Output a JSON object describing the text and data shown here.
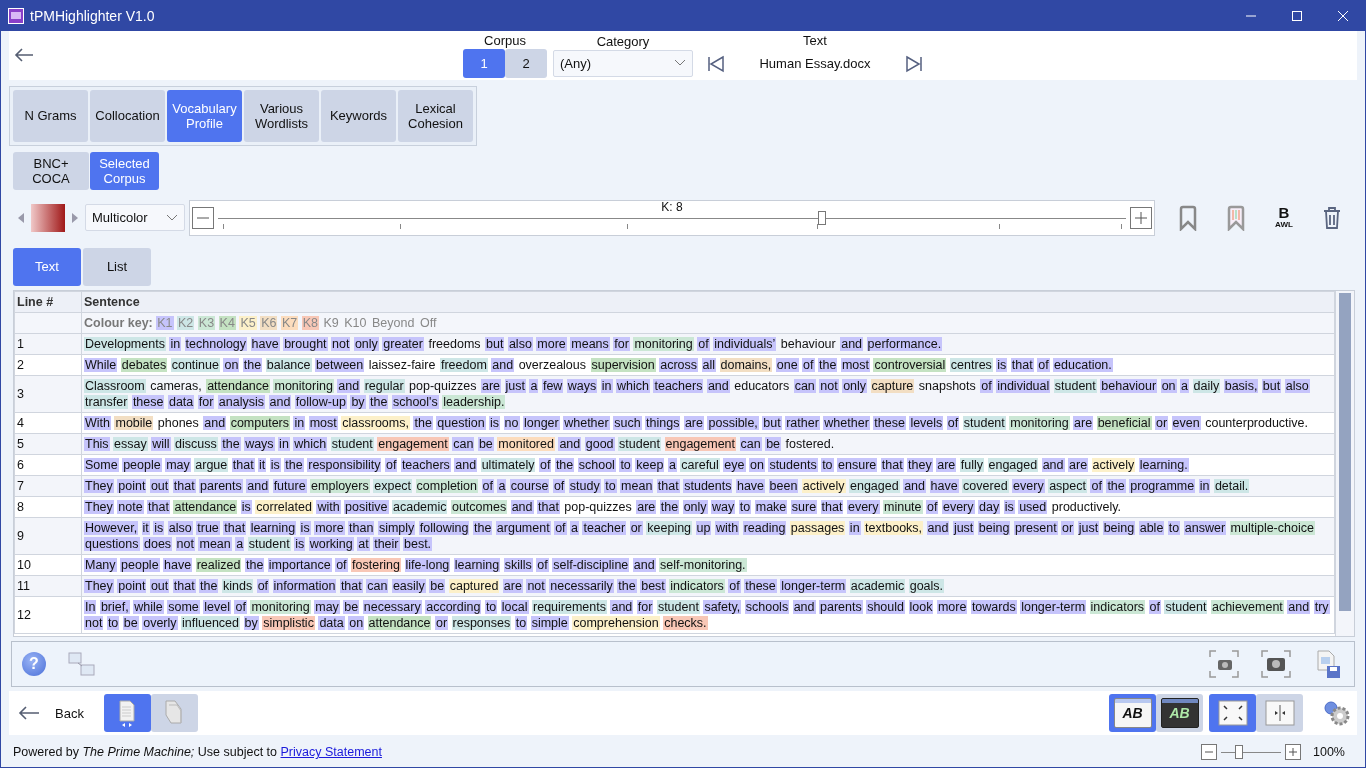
{
  "window": {
    "title": "tPMHighlighter V1.0"
  },
  "header": {
    "corpus": {
      "label": "Corpus",
      "options": [
        {
          "label": "1",
          "selected": true
        },
        {
          "label": "2",
          "selected": false
        }
      ]
    },
    "category": {
      "label": "Category",
      "value": "(Any)"
    },
    "text": {
      "label": "Text",
      "value": "Human Essay.docx"
    }
  },
  "tool_tabs": [
    {
      "label": "N Grams",
      "selected": false
    },
    {
      "label": "Collocation",
      "selected": false
    },
    {
      "label": "Vocabulary Profile",
      "selected": true
    },
    {
      "label": "Various Wordlists",
      "selected": false
    },
    {
      "label": "Keywords",
      "selected": false
    },
    {
      "label": "Lexical Cohesion",
      "selected": false
    }
  ],
  "reference_tabs": [
    {
      "label": "BNC+ COCA",
      "selected": false
    },
    {
      "label": "Selected Corpus",
      "selected": true
    }
  ],
  "palette": {
    "value": "Multicolor"
  },
  "k_slider": {
    "reading": "K: 8",
    "level": 0.665
  },
  "awl_button": {
    "letter": "B",
    "label": "AWL"
  },
  "view_tabs": [
    {
      "label": "Text",
      "selected": true
    },
    {
      "label": "List",
      "selected": false
    }
  ],
  "table": {
    "columns": [
      "Line #",
      "Sentence"
    ],
    "colour_key": {
      "label": "Colour key:",
      "items": [
        {
          "text": "K1",
          "color": "#c6c4fb"
        },
        {
          "text": "K2",
          "color": "#cde6e6"
        },
        {
          "text": "K3",
          "color": "#cbe7d5"
        },
        {
          "text": "K4",
          "color": "#c4e2c2"
        },
        {
          "text": "K5",
          "color": "#fcf0c9"
        },
        {
          "text": "K6",
          "color": "#f2dec3"
        },
        {
          "text": "K7",
          "color": "#fcdcbd"
        },
        {
          "text": "K8",
          "color": "#f8c7b6"
        },
        {
          "text": "K9"
        },
        {
          "text": "K10"
        },
        {
          "text": "Beyond"
        },
        {
          "text": "Off"
        }
      ]
    },
    "rows": [
      {
        "line": "1",
        "words": [
          {
            "text": "Developments",
            "color": "#cde6e6"
          },
          {
            "text": "in",
            "color": "#c6c4fb"
          },
          {
            "text": "technology",
            "color": "#c6c4fb"
          },
          {
            "text": "have",
            "color": "#c6c4fb"
          },
          {
            "text": "brought",
            "color": "#c6c4fb"
          },
          {
            "text": "not",
            "color": "#c6c4fb"
          },
          {
            "text": "only",
            "color": "#c6c4fb"
          },
          {
            "text": "greater",
            "color": "#c6c4fb"
          },
          {
            "text": "freedoms"
          },
          {
            "text": "but",
            "color": "#c6c4fb"
          },
          {
            "text": "also",
            "color": "#c6c4fb"
          },
          {
            "text": "more",
            "color": "#c6c4fb"
          },
          {
            "text": "means",
            "color": "#c6c4fb"
          },
          {
            "text": "for",
            "color": "#c6c4fb"
          },
          {
            "text": "monitoring",
            "color": "#cbe7d5"
          },
          {
            "text": "of",
            "color": "#c6c4fb"
          },
          {
            "text": "individuals’",
            "color": "#c6c4fb"
          },
          {
            "text": "behaviour"
          },
          {
            "text": "and",
            "color": "#c6c4fb"
          },
          {
            "text": "performance.",
            "color": "#c6c4fb"
          }
        ]
      },
      {
        "line": "2",
        "words": [
          {
            "text": "While",
            "color": "#c6c4fb"
          },
          {
            "text": "debates",
            "color": "#c4e2c2"
          },
          {
            "text": "continue",
            "color": "#cde6e6"
          },
          {
            "text": "on",
            "color": "#c6c4fb"
          },
          {
            "text": "the",
            "color": "#c6c4fb"
          },
          {
            "text": "balance",
            "color": "#cde6e6"
          },
          {
            "text": "between",
            "color": "#c6c4fb"
          },
          {
            "text": "laissez-faire"
          },
          {
            "text": "freedom",
            "color": "#cde6e6"
          },
          {
            "text": "and",
            "color": "#c6c4fb"
          },
          {
            "text": "overzealous"
          },
          {
            "text": "supervision",
            "color": "#c4e2c2"
          },
          {
            "text": "across",
            "color": "#c6c4fb"
          },
          {
            "text": "all",
            "color": "#c6c4fb"
          },
          {
            "text": "domains,",
            "color": "#f2dec3"
          },
          {
            "text": "one",
            "color": "#c6c4fb"
          },
          {
            "text": "of",
            "color": "#c6c4fb"
          },
          {
            "text": "the",
            "color": "#c6c4fb"
          },
          {
            "text": "most",
            "color": "#c6c4fb"
          },
          {
            "text": "controversial",
            "color": "#c4e2c2"
          },
          {
            "text": "centres",
            "color": "#cde6e6"
          },
          {
            "text": "is",
            "color": "#c6c4fb"
          },
          {
            "text": "that",
            "color": "#c6c4fb"
          },
          {
            "text": "of",
            "color": "#c6c4fb"
          },
          {
            "text": "education.",
            "color": "#c6c4fb"
          }
        ]
      },
      {
        "line": "3",
        "words": [
          {
            "text": "Classroom",
            "color": "#cde6e6"
          },
          {
            "text": "cameras,"
          },
          {
            "text": "attendance",
            "color": "#c4e2c2"
          },
          {
            "text": "monitoring",
            "color": "#cbe7d5"
          },
          {
            "text": "and",
            "color": "#c6c4fb"
          },
          {
            "text": "regular",
            "color": "#cde6e6"
          },
          {
            "text": "pop-quizzes"
          },
          {
            "text": "are",
            "color": "#c6c4fb"
          },
          {
            "text": "just",
            "color": "#c6c4fb"
          },
          {
            "text": "a",
            "color": "#c6c4fb"
          },
          {
            "text": "few",
            "color": "#c6c4fb"
          },
          {
            "text": "ways",
            "color": "#c6c4fb"
          },
          {
            "text": "in",
            "color": "#c6c4fb"
          },
          {
            "text": "which",
            "color": "#c6c4fb"
          },
          {
            "text": "teachers",
            "color": "#c6c4fb"
          },
          {
            "text": "and",
            "color": "#c6c4fb"
          },
          {
            "text": "educators"
          },
          {
            "text": "can",
            "color": "#c6c4fb"
          },
          {
            "text": "not",
            "color": "#c6c4fb"
          },
          {
            "text": "only",
            "color": "#c6c4fb"
          },
          {
            "text": "capture",
            "color": "#f2dec3"
          },
          {
            "text": "snapshots"
          },
          {
            "text": "of",
            "color": "#c6c4fb"
          },
          {
            "text": "individual",
            "color": "#c6c4fb"
          },
          {
            "text": "student",
            "color": "#cde6e6"
          },
          {
            "text": "behaviour",
            "color": "#c6c4fb"
          },
          {
            "text": "on",
            "color": "#c6c4fb"
          },
          {
            "text": "a",
            "color": "#c6c4fb"
          },
          {
            "text": "daily",
            "color": "#cde6e6"
          },
          {
            "text": "basis,",
            "color": "#c6c4fb"
          },
          {
            "text": "but",
            "color": "#c6c4fb"
          },
          {
            "text": "also",
            "color": "#c6c4fb"
          },
          {
            "text": "transfer",
            "color": "#cde6e6"
          },
          {
            "text": "these",
            "color": "#c6c4fb"
          },
          {
            "text": "data",
            "color": "#c6c4fb"
          },
          {
            "text": "for",
            "color": "#c6c4fb"
          },
          {
            "text": "analysis",
            "color": "#c6c4fb"
          },
          {
            "text": "and",
            "color": "#c6c4fb"
          },
          {
            "text": "follow-up",
            "color": "#c6c4fb"
          },
          {
            "text": "by",
            "color": "#c6c4fb"
          },
          {
            "text": "the",
            "color": "#c6c4fb"
          },
          {
            "text": "school's",
            "color": "#c6c4fb"
          },
          {
            "text": "leadership.",
            "color": "#cbe7d5"
          }
        ]
      },
      {
        "line": "4",
        "words": [
          {
            "text": "With",
            "color": "#c6c4fb"
          },
          {
            "text": "mobile",
            "color": "#f2dec3"
          },
          {
            "text": "phones"
          },
          {
            "text": "and",
            "color": "#c6c4fb"
          },
          {
            "text": "computers",
            "color": "#c4e2c2"
          },
          {
            "text": "in",
            "color": "#c6c4fb"
          },
          {
            "text": "most",
            "color": "#c6c4fb"
          },
          {
            "text": "classrooms,",
            "color": "#fcf0c9"
          },
          {
            "text": "the",
            "color": "#c6c4fb"
          },
          {
            "text": "question",
            "color": "#c6c4fb"
          },
          {
            "text": "is",
            "color": "#c6c4fb"
          },
          {
            "text": "no",
            "color": "#c6c4fb"
          },
          {
            "text": "longer",
            "color": "#c6c4fb"
          },
          {
            "text": "whether",
            "color": "#c6c4fb"
          },
          {
            "text": "such",
            "color": "#c6c4fb"
          },
          {
            "text": "things",
            "color": "#c6c4fb"
          },
          {
            "text": "are",
            "color": "#c6c4fb"
          },
          {
            "text": "possible,",
            "color": "#c6c4fb"
          },
          {
            "text": "but",
            "color": "#c6c4fb"
          },
          {
            "text": "rather",
            "color": "#c6c4fb"
          },
          {
            "text": "whether",
            "color": "#c6c4fb"
          },
          {
            "text": "these",
            "color": "#c6c4fb"
          },
          {
            "text": "levels",
            "color": "#c6c4fb"
          },
          {
            "text": "of",
            "color": "#c6c4fb"
          },
          {
            "text": "student",
            "color": "#cde6e6"
          },
          {
            "text": "monitoring",
            "color": "#cbe7d5"
          },
          {
            "text": "are",
            "color": "#c6c4fb"
          },
          {
            "text": "beneficial",
            "color": "#c4e2c2"
          },
          {
            "text": "or",
            "color": "#c6c4fb"
          },
          {
            "text": "even",
            "color": "#c6c4fb"
          },
          {
            "text": "counterproductive."
          }
        ]
      },
      {
        "line": "5",
        "words": [
          {
            "text": "This",
            "color": "#c6c4fb"
          },
          {
            "text": "essay",
            "color": "#cde6e6"
          },
          {
            "text": "will",
            "color": "#c6c4fb"
          },
          {
            "text": "discuss",
            "color": "#cde6e6"
          },
          {
            "text": "the",
            "color": "#c6c4fb"
          },
          {
            "text": "ways",
            "color": "#c6c4fb"
          },
          {
            "text": "in",
            "color": "#c6c4fb"
          },
          {
            "text": "which",
            "color": "#c6c4fb"
          },
          {
            "text": "student",
            "color": "#cde6e6"
          },
          {
            "text": "engagement",
            "color": "#f8c7b6"
          },
          {
            "text": "can",
            "color": "#c6c4fb"
          },
          {
            "text": "be",
            "color": "#c6c4fb"
          },
          {
            "text": "monitored",
            "color": "#fcdcbd"
          },
          {
            "text": "and",
            "color": "#c6c4fb"
          },
          {
            "text": "good",
            "color": "#c6c4fb"
          },
          {
            "text": "student",
            "color": "#cde6e6"
          },
          {
            "text": "engagement",
            "color": "#f8c7b6"
          },
          {
            "text": "can",
            "color": "#c6c4fb"
          },
          {
            "text": "be",
            "color": "#c6c4fb"
          },
          {
            "text": "fostered."
          }
        ]
      },
      {
        "line": "6",
        "words": [
          {
            "text": "Some",
            "color": "#c6c4fb"
          },
          {
            "text": "people",
            "color": "#c6c4fb"
          },
          {
            "text": "may",
            "color": "#c6c4fb"
          },
          {
            "text": "argue",
            "color": "#cde6e6"
          },
          {
            "text": "that",
            "color": "#c6c4fb"
          },
          {
            "text": "it",
            "color": "#c6c4fb"
          },
          {
            "text": "is",
            "color": "#c6c4fb"
          },
          {
            "text": "the",
            "color": "#c6c4fb"
          },
          {
            "text": "responsibility",
            "color": "#c6c4fb"
          },
          {
            "text": "of",
            "color": "#c6c4fb"
          },
          {
            "text": "teachers",
            "color": "#c6c4fb"
          },
          {
            "text": "and",
            "color": "#c6c4fb"
          },
          {
            "text": "ultimately",
            "color": "#cde6e6"
          },
          {
            "text": "of",
            "color": "#c6c4fb"
          },
          {
            "text": "the",
            "color": "#c6c4fb"
          },
          {
            "text": "school",
            "color": "#c6c4fb"
          },
          {
            "text": "to",
            "color": "#c6c4fb"
          },
          {
            "text": "keep",
            "color": "#c6c4fb"
          },
          {
            "text": "a",
            "color": "#c6c4fb"
          },
          {
            "text": "careful",
            "color": "#cde6e6"
          },
          {
            "text": "eye",
            "color": "#c6c4fb"
          },
          {
            "text": "on",
            "color": "#c6c4fb"
          },
          {
            "text": "students",
            "color": "#c6c4fb"
          },
          {
            "text": "to",
            "color": "#c6c4fb"
          },
          {
            "text": "ensure",
            "color": "#c6c4fb"
          },
          {
            "text": "that",
            "color": "#c6c4fb"
          },
          {
            "text": "they",
            "color": "#c6c4fb"
          },
          {
            "text": "are",
            "color": "#c6c4fb"
          },
          {
            "text": "fully",
            "color": "#cde6e6"
          },
          {
            "text": "engaged",
            "color": "#cde6e6"
          },
          {
            "text": "and",
            "color": "#c6c4fb"
          },
          {
            "text": "are",
            "color": "#c6c4fb"
          },
          {
            "text": "actively",
            "color": "#fcf0c9"
          },
          {
            "text": "learning.",
            "color": "#c6c4fb"
          }
        ]
      },
      {
        "line": "7",
        "words": [
          {
            "text": "They",
            "color": "#c6c4fb"
          },
          {
            "text": "point",
            "color": "#c6c4fb"
          },
          {
            "text": "out",
            "color": "#c6c4fb"
          },
          {
            "text": "that",
            "color": "#c6c4fb"
          },
          {
            "text": "parents",
            "color": "#c6c4fb"
          },
          {
            "text": "and",
            "color": "#c6c4fb"
          },
          {
            "text": "future",
            "color": "#c6c4fb"
          },
          {
            "text": "employers",
            "color": "#cbe7d5"
          },
          {
            "text": "expect",
            "color": "#cde6e6"
          },
          {
            "text": "completion",
            "color": "#cbe7d5"
          },
          {
            "text": "of",
            "color": "#c6c4fb"
          },
          {
            "text": "a",
            "color": "#c6c4fb"
          },
          {
            "text": "course",
            "color": "#c6c4fb"
          },
          {
            "text": "of",
            "color": "#c6c4fb"
          },
          {
            "text": "study",
            "color": "#c6c4fb"
          },
          {
            "text": "to",
            "color": "#c6c4fb"
          },
          {
            "text": "mean",
            "color": "#c6c4fb"
          },
          {
            "text": "that",
            "color": "#c6c4fb"
          },
          {
            "text": "students",
            "color": "#c6c4fb"
          },
          {
            "text": "have",
            "color": "#c6c4fb"
          },
          {
            "text": "been",
            "color": "#c6c4fb"
          },
          {
            "text": "actively",
            "color": "#fcf0c9"
          },
          {
            "text": "engaged",
            "color": "#cde6e6"
          },
          {
            "text": "and",
            "color": "#c6c4fb"
          },
          {
            "text": "have",
            "color": "#c6c4fb"
          },
          {
            "text": "covered",
            "color": "#cde6e6"
          },
          {
            "text": "every",
            "color": "#c6c4fb"
          },
          {
            "text": "aspect",
            "color": "#cde6e6"
          },
          {
            "text": "of",
            "color": "#c6c4fb"
          },
          {
            "text": "the",
            "color": "#c6c4fb"
          },
          {
            "text": "programme",
            "color": "#c6c4fb"
          },
          {
            "text": "in",
            "color": "#c6c4fb"
          },
          {
            "text": "detail.",
            "color": "#cde6e6"
          }
        ]
      },
      {
        "line": "8",
        "words": [
          {
            "text": "They",
            "color": "#c6c4fb"
          },
          {
            "text": "note",
            "color": "#c6c4fb"
          },
          {
            "text": "that",
            "color": "#c6c4fb"
          },
          {
            "text": "attendance",
            "color": "#c4e2c2"
          },
          {
            "text": "is",
            "color": "#c6c4fb"
          },
          {
            "text": "correlated",
            "color": "#fcf0c9"
          },
          {
            "text": "with",
            "color": "#c6c4fb"
          },
          {
            "text": "positive",
            "color": "#c6c4fb"
          },
          {
            "text": "academic",
            "color": "#cde6e6"
          },
          {
            "text": "outcomes",
            "color": "#cbe7d5"
          },
          {
            "text": "and",
            "color": "#c6c4fb"
          },
          {
            "text": "that",
            "color": "#c6c4fb"
          },
          {
            "text": "pop-quizzes"
          },
          {
            "text": "are",
            "color": "#c6c4fb"
          },
          {
            "text": "the",
            "color": "#c6c4fb"
          },
          {
            "text": "only",
            "color": "#c6c4fb"
          },
          {
            "text": "way",
            "color": "#c6c4fb"
          },
          {
            "text": "to",
            "color": "#c6c4fb"
          },
          {
            "text": "make",
            "color": "#c6c4fb"
          },
          {
            "text": "sure",
            "color": "#c6c4fb"
          },
          {
            "text": "that",
            "color": "#c6c4fb"
          },
          {
            "text": "every",
            "color": "#c6c4fb"
          },
          {
            "text": "minute",
            "color": "#cbe7d5"
          },
          {
            "text": "of",
            "color": "#c6c4fb"
          },
          {
            "text": "every",
            "color": "#c6c4fb"
          },
          {
            "text": "day",
            "color": "#c6c4fb"
          },
          {
            "text": "is",
            "color": "#c6c4fb"
          },
          {
            "text": "used",
            "color": "#c6c4fb"
          },
          {
            "text": "productively."
          }
        ]
      },
      {
        "line": "9",
        "words": [
          {
            "text": "However,",
            "color": "#c6c4fb"
          },
          {
            "text": "it",
            "color": "#c6c4fb"
          },
          {
            "text": "is",
            "color": "#c6c4fb"
          },
          {
            "text": "also",
            "color": "#c6c4fb"
          },
          {
            "text": "true",
            "color": "#c6c4fb"
          },
          {
            "text": "that",
            "color": "#c6c4fb"
          },
          {
            "text": "learning",
            "color": "#c6c4fb"
          },
          {
            "text": "is",
            "color": "#c6c4fb"
          },
          {
            "text": "more",
            "color": "#c6c4fb"
          },
          {
            "text": "than",
            "color": "#c6c4fb"
          },
          {
            "text": "simply",
            "color": "#c6c4fb"
          },
          {
            "text": "following",
            "color": "#c6c4fb"
          },
          {
            "text": "the",
            "color": "#c6c4fb"
          },
          {
            "text": "argument",
            "color": "#c6c4fb"
          },
          {
            "text": "of",
            "color": "#c6c4fb"
          },
          {
            "text": "a",
            "color": "#c6c4fb"
          },
          {
            "text": "teacher",
            "color": "#c6c4fb"
          },
          {
            "text": "or",
            "color": "#c6c4fb"
          },
          {
            "text": "keeping",
            "color": "#cde6e6"
          },
          {
            "text": "up",
            "color": "#c6c4fb"
          },
          {
            "text": "with",
            "color": "#c6c4fb"
          },
          {
            "text": "reading",
            "color": "#c6c4fb"
          },
          {
            "text": "passages",
            "color": "#fcf0c9"
          },
          {
            "text": "in",
            "color": "#c6c4fb"
          },
          {
            "text": "textbooks,",
            "color": "#fcf0c9"
          },
          {
            "text": "and",
            "color": "#c6c4fb"
          },
          {
            "text": "just",
            "color": "#c6c4fb"
          },
          {
            "text": "being",
            "color": "#c6c4fb"
          },
          {
            "text": "present",
            "color": "#c6c4fb"
          },
          {
            "text": "or",
            "color": "#c6c4fb"
          },
          {
            "text": "just",
            "color": "#c6c4fb"
          },
          {
            "text": "being",
            "color": "#c6c4fb"
          },
          {
            "text": "able",
            "color": "#c6c4fb"
          },
          {
            "text": "to",
            "color": "#c6c4fb"
          },
          {
            "text": "answer",
            "color": "#c6c4fb"
          },
          {
            "text": "multiple-choice",
            "color": "#cbe7d5"
          },
          {
            "text": "questions",
            "color": "#c6c4fb"
          },
          {
            "text": "does",
            "color": "#c6c4fb"
          },
          {
            "text": "not",
            "color": "#c6c4fb"
          },
          {
            "text": "mean",
            "color": "#c6c4fb"
          },
          {
            "text": "a",
            "color": "#c6c4fb"
          },
          {
            "text": "student",
            "color": "#cde6e6"
          },
          {
            "text": "is",
            "color": "#c6c4fb"
          },
          {
            "text": "working",
            "color": "#c6c4fb"
          },
          {
            "text": "at",
            "color": "#c6c4fb"
          },
          {
            "text": "their",
            "color": "#c6c4fb"
          },
          {
            "text": "best.",
            "color": "#c6c4fb"
          }
        ]
      },
      {
        "line": "10",
        "words": [
          {
            "text": "Many",
            "color": "#c6c4fb"
          },
          {
            "text": "people",
            "color": "#c6c4fb"
          },
          {
            "text": "have",
            "color": "#c6c4fb"
          },
          {
            "text": "realized",
            "color": "#c4e2c2"
          },
          {
            "text": "the",
            "color": "#c6c4fb"
          },
          {
            "text": "importance",
            "color": "#c6c4fb"
          },
          {
            "text": "of",
            "color": "#c6c4fb"
          },
          {
            "text": "fostering",
            "color": "#f8c7b6"
          },
          {
            "text": "life-long",
            "color": "#c6c4fb"
          },
          {
            "text": "learning",
            "color": "#c6c4fb"
          },
          {
            "text": "skills",
            "color": "#c6c4fb"
          },
          {
            "text": "of",
            "color": "#c6c4fb"
          },
          {
            "text": "self-discipline",
            "color": "#c6c4fb"
          },
          {
            "text": "and",
            "color": "#c6c4fb"
          },
          {
            "text": "self-monitoring.",
            "color": "#cbe7d5"
          }
        ]
      },
      {
        "line": "11",
        "words": [
          {
            "text": "They",
            "color": "#c6c4fb"
          },
          {
            "text": "point",
            "color": "#c6c4fb"
          },
          {
            "text": "out",
            "color": "#c6c4fb"
          },
          {
            "text": "that",
            "color": "#c6c4fb"
          },
          {
            "text": "the",
            "color": "#c6c4fb"
          },
          {
            "text": "kinds",
            "color": "#cde6e6"
          },
          {
            "text": "of",
            "color": "#c6c4fb"
          },
          {
            "text": "information",
            "color": "#c6c4fb"
          },
          {
            "text": "that",
            "color": "#c6c4fb"
          },
          {
            "text": "can",
            "color": "#c6c4fb"
          },
          {
            "text": "easily",
            "color": "#c6c4fb"
          },
          {
            "text": "be",
            "color": "#c6c4fb"
          },
          {
            "text": "captured",
            "color": "#fcf0c9"
          },
          {
            "text": "are",
            "color": "#c6c4fb"
          },
          {
            "text": "not",
            "color": "#c6c4fb"
          },
          {
            "text": "necessarily",
            "color": "#c6c4fb"
          },
          {
            "text": "the",
            "color": "#c6c4fb"
          },
          {
            "text": "best",
            "color": "#c6c4fb"
          },
          {
            "text": "indicators",
            "color": "#cbe7d5"
          },
          {
            "text": "of",
            "color": "#c6c4fb"
          },
          {
            "text": "these",
            "color": "#c6c4fb"
          },
          {
            "text": "longer-term",
            "color": "#c6c4fb"
          },
          {
            "text": "academic",
            "color": "#cde6e6"
          },
          {
            "text": "goals.",
            "color": "#cde6e6"
          }
        ]
      },
      {
        "line": "12",
        "words": [
          {
            "text": "In",
            "color": "#c6c4fb"
          },
          {
            "text": "brief,",
            "color": "#c6c4fb"
          },
          {
            "text": "while",
            "color": "#c6c4fb"
          },
          {
            "text": "some",
            "color": "#c6c4fb"
          },
          {
            "text": "level",
            "color": "#c6c4fb"
          },
          {
            "text": "of",
            "color": "#c6c4fb"
          },
          {
            "text": "monitoring",
            "color": "#cbe7d5"
          },
          {
            "text": "may",
            "color": "#c6c4fb"
          },
          {
            "text": "be",
            "color": "#c6c4fb"
          },
          {
            "text": "necessary",
            "color": "#c6c4fb"
          },
          {
            "text": "according",
            "color": "#c6c4fb"
          },
          {
            "text": "to",
            "color": "#c6c4fb"
          },
          {
            "text": "local",
            "color": "#c6c4fb"
          },
          {
            "text": "requirements",
            "color": "#cde6e6"
          },
          {
            "text": "and",
            "color": "#c6c4fb"
          },
          {
            "text": "for",
            "color": "#c6c4fb"
          },
          {
            "text": "student",
            "color": "#cde6e6"
          },
          {
            "text": "safety,",
            "color": "#c6c4fb"
          },
          {
            "text": "schools",
            "color": "#c6c4fb"
          },
          {
            "text": "and",
            "color": "#c6c4fb"
          },
          {
            "text": "parents",
            "color": "#c6c4fb"
          },
          {
            "text": "should",
            "color": "#c6c4fb"
          },
          {
            "text": "look",
            "color": "#c6c4fb"
          },
          {
            "text": "more",
            "color": "#c6c4fb"
          },
          {
            "text": "towards",
            "color": "#c6c4fb"
          },
          {
            "text": "longer-term",
            "color": "#c6c4fb"
          },
          {
            "text": "indicators",
            "color": "#cbe7d5"
          },
          {
            "text": "of",
            "color": "#c6c4fb"
          },
          {
            "text": "student",
            "color": "#cde6e6"
          },
          {
            "text": "achievement",
            "color": "#cbe7d5"
          },
          {
            "text": "and",
            "color": "#c6c4fb"
          },
          {
            "text": "try",
            "color": "#c6c4fb"
          },
          {
            "text": "not",
            "color": "#c6c4fb"
          },
          {
            "text": "to",
            "color": "#c6c4fb"
          },
          {
            "text": "be",
            "color": "#c6c4fb"
          },
          {
            "text": "overly",
            "color": "#c6c4fb"
          },
          {
            "text": "influenced",
            "color": "#cde6e6"
          },
          {
            "text": "by",
            "color": "#c6c4fb"
          },
          {
            "text": "simplistic",
            "color": "#f8c7b6"
          },
          {
            "text": "data",
            "color": "#c6c4fb"
          },
          {
            "text": "on",
            "color": "#c6c4fb"
          },
          {
            "text": "attendance",
            "color": "#c4e2c2"
          },
          {
            "text": "or",
            "color": "#c6c4fb"
          },
          {
            "text": "responses",
            "color": "#cde6e6"
          },
          {
            "text": "to",
            "color": "#c6c4fb"
          },
          {
            "text": "simple",
            "color": "#c6c4fb"
          },
          {
            "text": "comprehension",
            "color": "#fcf0c9"
          },
          {
            "text": "checks.",
            "color": "#f8c7b6"
          }
        ]
      }
    ]
  },
  "help_button": {
    "label": "?"
  },
  "back_button": {
    "label": "Back"
  },
  "document_modes": [
    {
      "kind": "single",
      "selected": true
    },
    {
      "kind": "multiple",
      "selected": false
    }
  ],
  "display_modes": [
    {
      "kind": "light",
      "label": "AB",
      "selected": true
    },
    {
      "kind": "dark",
      "label": "AB",
      "selected": false
    }
  ],
  "layout_modes": [
    {
      "kind": "fit",
      "selected": true
    },
    {
      "kind": "split",
      "selected": false
    }
  ],
  "footer": {
    "credit": "Powered by *The Prime Machine;*  Use subject to",
    "link": "Privacy Statement",
    "zoom": {
      "level": 0.3,
      "reading": "100%"
    }
  }
}
